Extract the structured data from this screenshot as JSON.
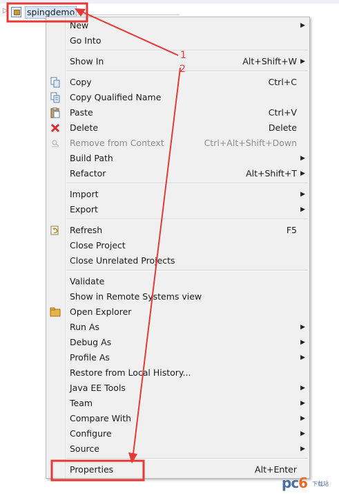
{
  "tree": {
    "project_label": "spingdemo"
  },
  "menu": {
    "items": [
      {
        "label": "New",
        "accel": "",
        "submenu": true,
        "disabled": false,
        "icon": "",
        "name": "menu-item-new"
      },
      {
        "label": "Go Into",
        "accel": "",
        "submenu": false,
        "disabled": false,
        "icon": "",
        "name": "menu-item-go-into"
      },
      {
        "label": "Show In",
        "accel": "Alt+Shift+W",
        "submenu": true,
        "disabled": false,
        "icon": "",
        "name": "menu-item-show-in"
      },
      {
        "label": "Copy",
        "accel": "Ctrl+C",
        "submenu": false,
        "disabled": false,
        "icon": "copy-icon",
        "name": "menu-item-copy"
      },
      {
        "label": "Copy Qualified Name",
        "accel": "",
        "submenu": false,
        "disabled": false,
        "icon": "copy-qualified-name-icon",
        "name": "menu-item-copy-qualified-name"
      },
      {
        "label": "Paste",
        "accel": "Ctrl+V",
        "submenu": false,
        "disabled": false,
        "icon": "paste-icon",
        "name": "menu-item-paste"
      },
      {
        "label": "Delete",
        "accel": "Delete",
        "submenu": false,
        "disabled": false,
        "icon": "delete-icon",
        "name": "menu-item-delete"
      },
      {
        "label": "Remove from Context",
        "accel": "Ctrl+Alt+Shift+Down",
        "submenu": false,
        "disabled": true,
        "icon": "remove-context-icon",
        "name": "menu-item-remove-from-context"
      },
      {
        "label": "Build Path",
        "accel": "",
        "submenu": true,
        "disabled": false,
        "icon": "",
        "name": "menu-item-build-path"
      },
      {
        "label": "Refactor",
        "accel": "Alt+Shift+T",
        "submenu": true,
        "disabled": false,
        "icon": "",
        "name": "menu-item-refactor"
      },
      {
        "label": "Import",
        "accel": "",
        "submenu": true,
        "disabled": false,
        "icon": "",
        "name": "menu-item-import"
      },
      {
        "label": "Export",
        "accel": "",
        "submenu": true,
        "disabled": false,
        "icon": "",
        "name": "menu-item-export"
      },
      {
        "label": "Refresh",
        "accel": "F5",
        "submenu": false,
        "disabled": false,
        "icon": "refresh-icon",
        "name": "menu-item-refresh"
      },
      {
        "label": "Close Project",
        "accel": "",
        "submenu": false,
        "disabled": false,
        "icon": "",
        "name": "menu-item-close-project"
      },
      {
        "label": "Close Unrelated Projects",
        "accel": "",
        "submenu": false,
        "disabled": false,
        "icon": "",
        "name": "menu-item-close-unrelated-projects"
      },
      {
        "label": "Validate",
        "accel": "",
        "submenu": false,
        "disabled": false,
        "icon": "",
        "name": "menu-item-validate"
      },
      {
        "label": "Show in Remote Systems view",
        "accel": "",
        "submenu": false,
        "disabled": false,
        "icon": "",
        "name": "menu-item-show-in-remote-systems"
      },
      {
        "label": "Open Explorer",
        "accel": "",
        "submenu": false,
        "disabled": false,
        "icon": "open-explorer-icon",
        "name": "menu-item-open-explorer"
      },
      {
        "label": "Run As",
        "accel": "",
        "submenu": true,
        "disabled": false,
        "icon": "",
        "name": "menu-item-run-as"
      },
      {
        "label": "Debug As",
        "accel": "",
        "submenu": true,
        "disabled": false,
        "icon": "",
        "name": "menu-item-debug-as"
      },
      {
        "label": "Profile As",
        "accel": "",
        "submenu": true,
        "disabled": false,
        "icon": "",
        "name": "menu-item-profile-as"
      },
      {
        "label": "Restore from Local History...",
        "accel": "",
        "submenu": false,
        "disabled": false,
        "icon": "",
        "name": "menu-item-restore-local-history"
      },
      {
        "label": "Java EE Tools",
        "accel": "",
        "submenu": true,
        "disabled": false,
        "icon": "",
        "name": "menu-item-java-ee-tools"
      },
      {
        "label": "Team",
        "accel": "",
        "submenu": true,
        "disabled": false,
        "icon": "",
        "name": "menu-item-team"
      },
      {
        "label": "Compare With",
        "accel": "",
        "submenu": true,
        "disabled": false,
        "icon": "",
        "name": "menu-item-compare-with"
      },
      {
        "label": "Configure",
        "accel": "",
        "submenu": true,
        "disabled": false,
        "icon": "",
        "name": "menu-item-configure"
      },
      {
        "label": "Source",
        "accel": "",
        "submenu": true,
        "disabled": false,
        "icon": "",
        "name": "menu-item-source"
      },
      {
        "label": "Properties",
        "accel": "Alt+Enter",
        "submenu": false,
        "disabled": false,
        "icon": "",
        "name": "menu-item-properties"
      }
    ],
    "submenu_glyph": "▶"
  },
  "annotations": {
    "step1": "1",
    "step2": "2",
    "color": "#e53935"
  },
  "watermark": {
    "text_a": "pc",
    "text_b": "6",
    "small": "下载站"
  }
}
